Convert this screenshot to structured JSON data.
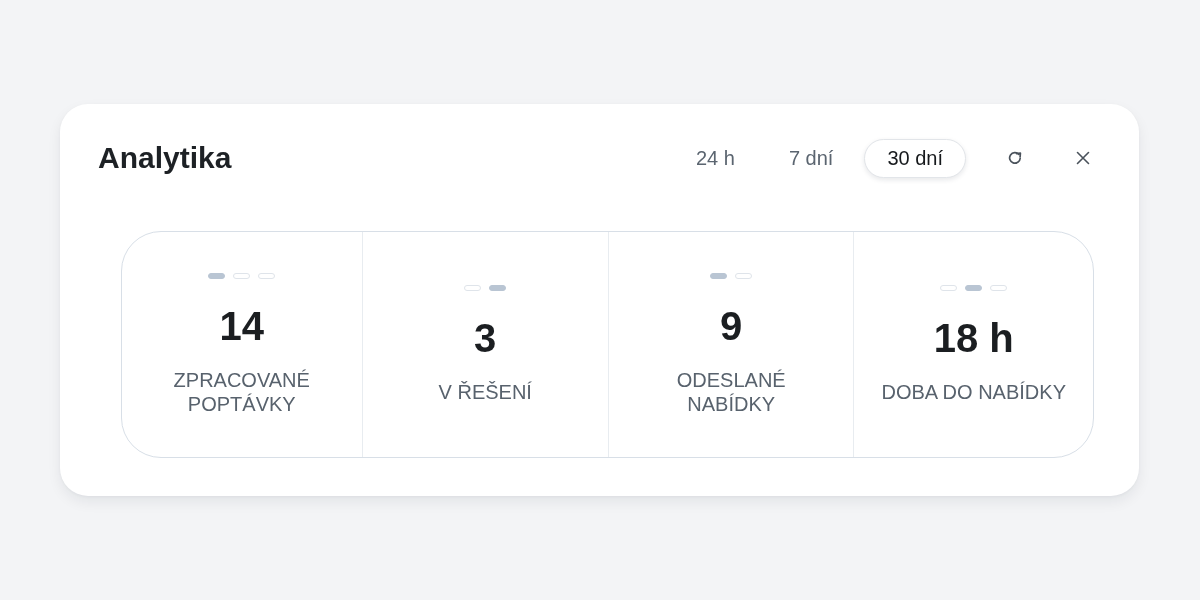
{
  "title": "Analytika",
  "ranges": [
    {
      "label": "24 h",
      "selected": false
    },
    {
      "label": "7 dní",
      "selected": false
    },
    {
      "label": "30 dní",
      "selected": true
    }
  ],
  "stats": [
    {
      "value": "14",
      "label": "ZPRACOVANÉ POPTÁVKY",
      "pills": [
        {
          "selected": true
        },
        {
          "selected": false
        },
        {
          "selected": false
        }
      ]
    },
    {
      "value": "3",
      "label": "V ŘEŠENÍ",
      "pills": [
        {
          "selected": false
        },
        {
          "selected": true
        }
      ]
    },
    {
      "value": "9",
      "label": "ODESLANÉ NABÍDKY",
      "pills": [
        {
          "selected": true
        },
        {
          "selected": false
        }
      ]
    },
    {
      "value": "18 h",
      "label": "DOBA DO NABÍDKY",
      "pills": [
        {
          "selected": false
        },
        {
          "selected": true
        },
        {
          "selected": false
        }
      ]
    }
  ]
}
